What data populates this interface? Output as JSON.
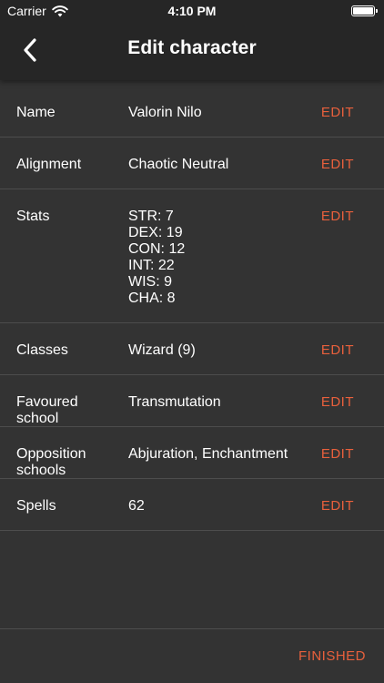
{
  "status_bar": {
    "carrier": "Carrier",
    "time": "4:10 PM",
    "wifi_icon": "wifi-icon",
    "battery_icon": "battery-icon"
  },
  "nav": {
    "back_icon": "chevron-left-icon",
    "title": "Edit character"
  },
  "rows": [
    {
      "label": "Name",
      "value": "Valorin Nilo",
      "action": "EDIT"
    },
    {
      "label": "Alignment",
      "value": "Chaotic Neutral",
      "action": "EDIT"
    },
    {
      "label": "Stats",
      "values": [
        "STR: 7",
        "DEX: 19",
        "CON: 12",
        "INT: 22",
        "WIS: 9",
        "CHA: 8"
      ],
      "action": "EDIT"
    },
    {
      "label": "Classes",
      "value": "Wizard (9)",
      "action": "EDIT"
    },
    {
      "label": "Favoured school",
      "value": "Transmutation",
      "action": "EDIT"
    },
    {
      "label": "Opposition schools",
      "value": "Abjuration, Enchantment",
      "action": "EDIT"
    },
    {
      "label": "Spells",
      "value": "62",
      "action": "EDIT"
    }
  ],
  "footer": {
    "finished_label": "FINISHED"
  },
  "colors": {
    "background": "#333333",
    "header": "#262626",
    "accent": "#e8603c",
    "divider": "#4d4d4d",
    "text": "#ffffff"
  }
}
